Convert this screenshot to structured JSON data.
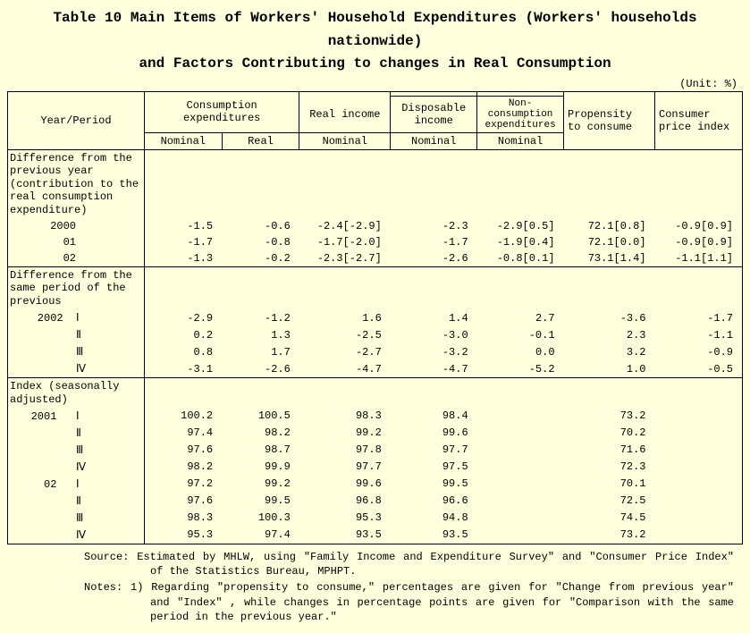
{
  "title_line1": "Table 10  Main Items of Workers' Household Expenditures (Workers' households nationwide)",
  "title_line2": "and Factors Contributing to changes in Real Consumption",
  "unit": "(Unit: %)",
  "head": {
    "yp": "Year/Period",
    "ce": "Consumption expenditures",
    "ri": "Real income",
    "di": "Disposable income",
    "nce": "Non-consumption expenditures",
    "ptc": "Propensity to consume",
    "cpi": "Consumer price index",
    "nom": "Nominal",
    "real": "Real"
  },
  "sec1": "Difference from the previous year (contribution to the real consumption expenditure)",
  "sec2": "Difference from the same period of the previous",
  "sec3": "Index (seasonally adjusted)",
  "rows1": [
    {
      "l": "      2000",
      "c1": "-1.5",
      "c2": "-0.6",
      "c3": "-2.4[-2.9]",
      "c4": "-2.3",
      "c5": "-2.9[0.5]",
      "c6": "72.1[0.8]",
      "c7": "-0.9[0.9]"
    },
    {
      "l": "        01",
      "c1": "-1.7",
      "c2": "-0.8",
      "c3": "-1.7[-2.0]",
      "c4": "-1.7",
      "c5": "-1.9[0.4]",
      "c6": "72.1[0.0]",
      "c7": "-0.9[0.9]"
    },
    {
      "l": "        02",
      "c1": "-1.3",
      "c2": "-0.2",
      "c3": "-2.3[-2.7]",
      "c4": "-2.6",
      "c5": "-0.8[0.1]",
      "c6": "73.1[1.4]",
      "c7": "-1.1[1.1]"
    }
  ],
  "rows2": [
    {
      "l": "    2002  Ⅰ",
      "c1": "-2.9",
      "c2": "-1.2",
      "c3": "1.6",
      "c4": "1.4",
      "c5": "2.7",
      "c6": "-3.6",
      "c7": "-1.7"
    },
    {
      "l": "          Ⅱ",
      "c1": "0.2",
      "c2": "1.3",
      "c3": "-2.5",
      "c4": "-3.0",
      "c5": "-0.1",
      "c6": "2.3",
      "c7": "-1.1"
    },
    {
      "l": "          Ⅲ",
      "c1": "0.8",
      "c2": "1.7",
      "c3": "-2.7",
      "c4": "-3.2",
      "c5": "0.0",
      "c6": "3.2",
      "c7": "-0.9"
    },
    {
      "l": "          Ⅳ",
      "c1": "-3.1",
      "c2": "-2.6",
      "c3": "-4.7",
      "c4": "-4.7",
      "c5": "-5.2",
      "c6": "1.0",
      "c7": "-0.5"
    }
  ],
  "rows3": [
    {
      "l": "   2001   Ⅰ",
      "c1": "100.2",
      "c2": "100.5",
      "c3": "98.3",
      "c4": "98.4",
      "c5": "",
      "c6": "73.2",
      "c7": ""
    },
    {
      "l": "          Ⅱ",
      "c1": "97.4",
      "c2": "98.2",
      "c3": "99.2",
      "c4": "99.6",
      "c5": "",
      "c6": "70.2",
      "c7": ""
    },
    {
      "l": "          Ⅲ",
      "c1": "97.6",
      "c2": "98.7",
      "c3": "97.8",
      "c4": "97.7",
      "c5": "",
      "c6": "71.6",
      "c7": ""
    },
    {
      "l": "          Ⅳ",
      "c1": "98.2",
      "c2": "99.9",
      "c3": "97.7",
      "c4": "97.5",
      "c5": "",
      "c6": "72.3",
      "c7": ""
    },
    {
      "l": "     02   Ⅰ",
      "c1": "97.2",
      "c2": "99.2",
      "c3": "99.6",
      "c4": "99.5",
      "c5": "",
      "c6": "70.1",
      "c7": ""
    },
    {
      "l": "          Ⅱ",
      "c1": "97.6",
      "c2": "99.5",
      "c3": "96.8",
      "c4": "96.6",
      "c5": "",
      "c6": "72.5",
      "c7": ""
    },
    {
      "l": "          Ⅲ",
      "c1": "98.3",
      "c2": "100.3",
      "c3": "95.3",
      "c4": "94.8",
      "c5": "",
      "c6": "74.5",
      "c7": ""
    },
    {
      "l": "          Ⅳ",
      "c1": "95.3",
      "c2": "97.4",
      "c3": "93.5",
      "c4": "93.5",
      "c5": "",
      "c6": "73.2",
      "c7": ""
    }
  ],
  "source": "Source:  Estimated by MHLW, using \"Family Income and Expenditure Survey\" and \"Consumer Price Index\" of the Statistics Bureau, MPHPT.",
  "notes": "Notes: 1)  Regarding  \"propensity to consume,\"  percentages are given for  \"Change from previous year\"  and \"Index\" , while changes in percentage points are given for  \"Comparison with the same period in the previous year.\"",
  "chart_data": {
    "type": "table",
    "title": "Main Items of Workers' Household Expenditures and Factors Contributing to changes in Real Consumption",
    "unit": "%",
    "columns": [
      "Consumption expenditures Nominal",
      "Consumption expenditures Real",
      "Real income Nominal",
      "Disposable income Nominal",
      "Non-consumption expenditures Nominal",
      "Propensity to consume",
      "Consumer price index"
    ],
    "sections": [
      {
        "name": "Difference from the previous year",
        "rows": [
          {
            "period": "2000",
            "v": [
              -1.5,
              -0.6,
              -2.4,
              -2.3,
              -2.9,
              72.1,
              -0.9
            ],
            "contrib": [
              null,
              null,
              -2.9,
              null,
              0.5,
              0.8,
              0.9
            ]
          },
          {
            "period": "2001",
            "v": [
              -1.7,
              -0.8,
              -1.7,
              -1.7,
              -1.9,
              72.1,
              -0.9
            ],
            "contrib": [
              null,
              null,
              -2.0,
              null,
              0.4,
              0.0,
              0.9
            ]
          },
          {
            "period": "2002",
            "v": [
              -1.3,
              -0.2,
              -2.3,
              -2.6,
              -0.8,
              73.1,
              -1.1
            ],
            "contrib": [
              null,
              null,
              -2.7,
              null,
              0.1,
              1.4,
              1.1
            ]
          }
        ]
      },
      {
        "name": "Difference from the same period of the previous year",
        "rows": [
          {
            "period": "2002 I",
            "v": [
              -2.9,
              -1.2,
              1.6,
              1.4,
              2.7,
              -3.6,
              -1.7
            ]
          },
          {
            "period": "2002 II",
            "v": [
              0.2,
              1.3,
              -2.5,
              -3.0,
              -0.1,
              2.3,
              -1.1
            ]
          },
          {
            "period": "2002 III",
            "v": [
              0.8,
              1.7,
              -2.7,
              -3.2,
              0.0,
              3.2,
              -0.9
            ]
          },
          {
            "period": "2002 IV",
            "v": [
              -3.1,
              -2.6,
              -4.7,
              -4.7,
              -5.2,
              1.0,
              -0.5
            ]
          }
        ]
      },
      {
        "name": "Index (seasonally adjusted)",
        "rows": [
          {
            "period": "2001 I",
            "v": [
              100.2,
              100.5,
              98.3,
              98.4,
              null,
              73.2,
              null
            ]
          },
          {
            "period": "2001 II",
            "v": [
              97.4,
              98.2,
              99.2,
              99.6,
              null,
              70.2,
              null
            ]
          },
          {
            "period": "2001 III",
            "v": [
              97.6,
              98.7,
              97.8,
              97.7,
              null,
              71.6,
              null
            ]
          },
          {
            "period": "2001 IV",
            "v": [
              98.2,
              99.9,
              97.7,
              97.5,
              null,
              72.3,
              null
            ]
          },
          {
            "period": "2002 I",
            "v": [
              97.2,
              99.2,
              99.6,
              99.5,
              null,
              70.1,
              null
            ]
          },
          {
            "period": "2002 II",
            "v": [
              97.6,
              99.5,
              96.8,
              96.6,
              null,
              72.5,
              null
            ]
          },
          {
            "period": "2002 III",
            "v": [
              98.3,
              100.3,
              95.3,
              94.8,
              null,
              74.5,
              null
            ]
          },
          {
            "period": "2002 IV",
            "v": [
              95.3,
              97.4,
              93.5,
              93.5,
              null,
              73.2,
              null
            ]
          }
        ]
      }
    ]
  }
}
